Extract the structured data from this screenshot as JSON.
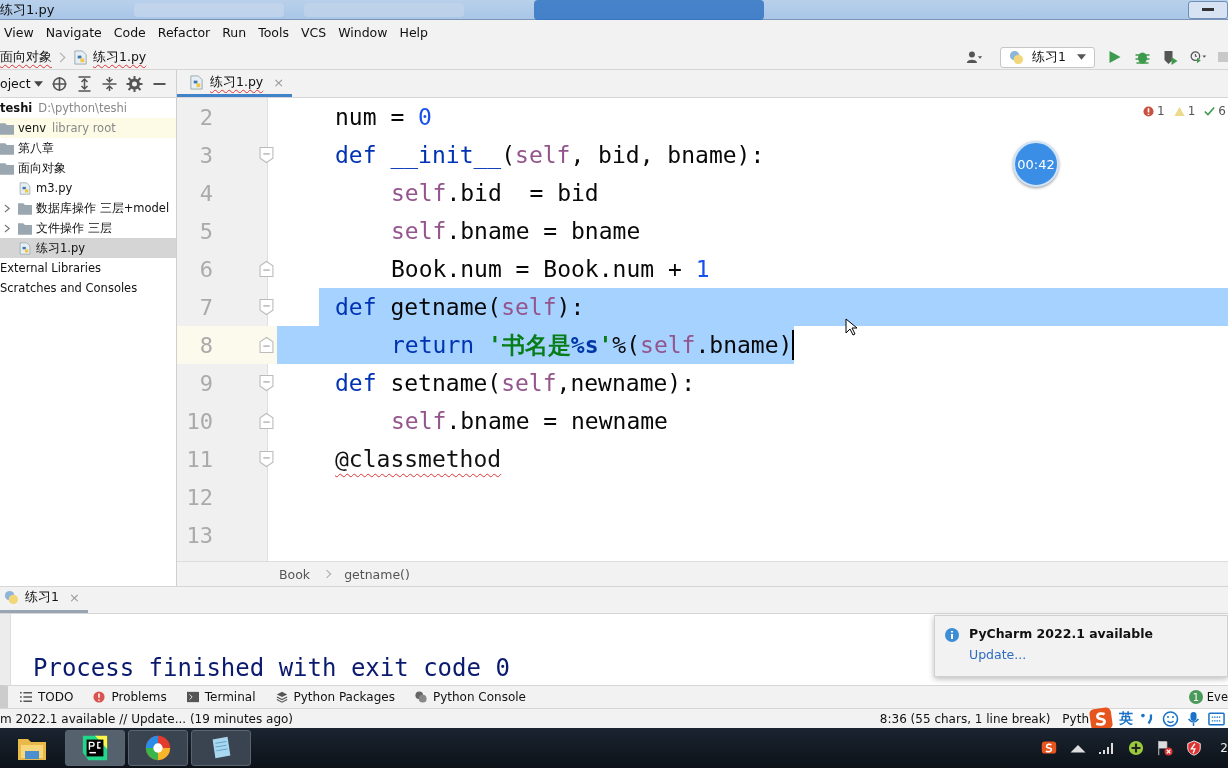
{
  "title_bar": {
    "title": "练习1.py"
  },
  "menu": [
    "View",
    "Navigate",
    "Code",
    "Refactor",
    "Run",
    "Tools",
    "VCS",
    "Window",
    "Help"
  ],
  "nav_path": [
    "面向对象",
    "练习1.py"
  ],
  "run_config": {
    "label": "练习1"
  },
  "project_panel": {
    "label": "oject"
  },
  "tree": [
    {
      "name": "teshi",
      "hint": "D:\\python\\teshi",
      "kind": "root",
      "selected": false,
      "children": [
        {
          "name": "venv",
          "hint": "library root",
          "kind": "folder",
          "selected": false,
          "highlighted": true
        },
        {
          "name": "第八章",
          "kind": "folder",
          "selected": false
        },
        {
          "name": "面向对象",
          "kind": "folder",
          "selected": false,
          "children": [
            {
              "name": "m3.py",
              "kind": "py",
              "selected": false
            },
            {
              "name": "数据库操作 三层+model",
              "kind": "folder",
              "selected": false,
              "expandable": true
            },
            {
              "name": "文件操作 三层",
              "kind": "folder",
              "selected": false,
              "expandable": true
            },
            {
              "name": "练习1.py",
              "kind": "py",
              "selected": true
            }
          ]
        }
      ]
    },
    {
      "name": "External Libraries",
      "kind": "plain",
      "selected": false
    },
    {
      "name": "Scratches and Consoles",
      "kind": "plain",
      "selected": false
    }
  ],
  "editor_tab": {
    "label": "练习1.py",
    "close": "×",
    "selected": true
  },
  "inspections": {
    "errors": "1",
    "warnings": "1",
    "ok": "6"
  },
  "timer": "00:42",
  "lines": [
    {
      "no": "2",
      "tokens": [
        {
          "kind": "plain",
          "text": "num = "
        },
        {
          "kind": "num",
          "text": "0"
        }
      ]
    },
    {
      "no": "3",
      "fold_start": true,
      "tokens": [
        {
          "kind": "kw",
          "text": "def "
        },
        {
          "kind": "fn",
          "text": "__init__"
        },
        {
          "kind": "plain",
          "text": "("
        },
        {
          "kind": "self",
          "text": "self"
        },
        {
          "kind": "plain",
          "text": ", bid, bname):"
        }
      ]
    },
    {
      "no": "4",
      "indented": true,
      "tokens": [
        {
          "kind": "self",
          "text": "self"
        },
        {
          "kind": "plain",
          "text": ".bid  = bid"
        }
      ]
    },
    {
      "no": "5",
      "indented": true,
      "tokens": [
        {
          "kind": "self",
          "text": "self"
        },
        {
          "kind": "plain",
          "text": ".bname = bname"
        }
      ]
    },
    {
      "no": "6",
      "fold_end": true,
      "indented": true,
      "tokens": [
        {
          "kind": "plain",
          "text": "Book.num = Book.num + "
        },
        {
          "kind": "num",
          "text": "1"
        }
      ]
    },
    {
      "no": "7",
      "fold_start": true,
      "selected": true,
      "selection_from_margin": false,
      "tokens": [
        {
          "kind": "kw",
          "text": "def "
        },
        {
          "kind": "plain",
          "text": "getname("
        },
        {
          "kind": "self",
          "text": "self"
        },
        {
          "kind": "plain",
          "text": "):"
        }
      ]
    },
    {
      "no": "8",
      "fold_end": true,
      "indented": true,
      "selected": true,
      "selection_from_margin": true,
      "caret": true,
      "tokens": [
        {
          "kind": "kw",
          "text": "return "
        },
        {
          "kind": "str",
          "text": "'书名是"
        },
        {
          "kind": "fmt",
          "text": "%s"
        },
        {
          "kind": "str",
          "text": "'"
        },
        {
          "kind": "plain",
          "text": "%("
        },
        {
          "kind": "self",
          "text": "self"
        },
        {
          "kind": "plain",
          "text": ".bname)"
        }
      ]
    },
    {
      "no": "9",
      "fold_start": true,
      "tokens": [
        {
          "kind": "kw",
          "text": "def "
        },
        {
          "kind": "plain",
          "text": "setname("
        },
        {
          "kind": "self",
          "text": "self"
        },
        {
          "kind": "plain",
          "text": ",newname):"
        }
      ]
    },
    {
      "no": "10",
      "fold_end": true,
      "indented": true,
      "tokens": [
        {
          "kind": "self",
          "text": "self"
        },
        {
          "kind": "plain",
          "text": ".bname = newname"
        }
      ]
    },
    {
      "no": "11",
      "fold_start": true,
      "tokens": [
        {
          "kind": "deco",
          "text": "@classmethod"
        }
      ]
    },
    {
      "no": "12"
    },
    {
      "no": "13"
    }
  ],
  "breadcrumbs": [
    "Book",
    "getname()"
  ],
  "run_tab": {
    "label": "练习1",
    "close": "×"
  },
  "console": "Process finished with exit code 0",
  "notification": {
    "title": "PyCharm 2022.1 available",
    "link": "Update..."
  },
  "tool_windows": [
    {
      "label": "TODO",
      "kind": "todo"
    },
    {
      "label": "Problems",
      "kind": "problems"
    },
    {
      "label": "Terminal",
      "kind": "terminal"
    },
    {
      "label": "Python Packages",
      "kind": "packages"
    },
    {
      "label": "Python Console",
      "kind": "console"
    }
  ],
  "event_log": {
    "count": "1",
    "label": "Eve"
  },
  "status": {
    "message": "m 2022.1 available // Update... (19 minutes ago)",
    "position": "8:36 (55 chars, 1 line break)",
    "interpreter": "Pyth",
    "ime": "英"
  },
  "taskbar": {
    "apps": [
      {
        "kind": "folder",
        "selected": false
      },
      {
        "kind": "pycharm",
        "selected": true
      },
      {
        "kind": "browser",
        "selected": false
      },
      {
        "kind": "notepad",
        "selected": false
      }
    ],
    "clock": "2"
  }
}
